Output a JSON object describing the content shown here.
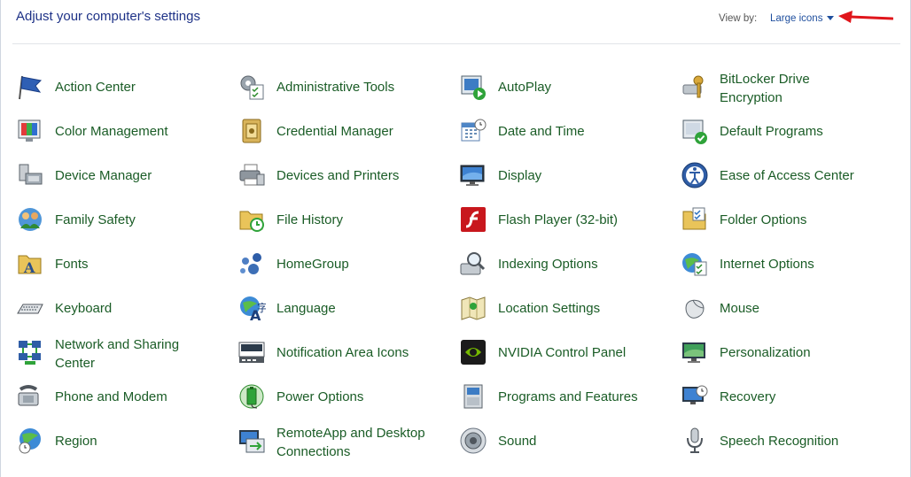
{
  "header": {
    "title": "Adjust your computer's settings",
    "view_by_label": "View by:",
    "view_by_value": "Large icons"
  },
  "accent_color": "#1a5c26",
  "annotation_color": "#e0151b",
  "items": [
    {
      "label": "Action Center",
      "icon": "flag-icon"
    },
    {
      "label": "Administrative Tools",
      "icon": "admin-tools-icon"
    },
    {
      "label": "AutoPlay",
      "icon": "autoplay-icon"
    },
    {
      "label": "BitLocker Drive Encryption",
      "icon": "bitlocker-keys-icon"
    },
    {
      "label": "Color Management",
      "icon": "color-management-icon"
    },
    {
      "label": "Credential Manager",
      "icon": "credential-vault-icon"
    },
    {
      "label": "Date and Time",
      "icon": "calendar-clock-icon"
    },
    {
      "label": "Default Programs",
      "icon": "default-programs-icon"
    },
    {
      "label": "Device Manager",
      "icon": "device-manager-icon"
    },
    {
      "label": "Devices and Printers",
      "icon": "printer-icon"
    },
    {
      "label": "Display",
      "icon": "monitor-icon"
    },
    {
      "label": "Ease of Access Center",
      "icon": "ease-of-access-icon"
    },
    {
      "label": "Family Safety",
      "icon": "family-safety-icon"
    },
    {
      "label": "File History",
      "icon": "file-history-icon"
    },
    {
      "label": "Flash Player (32-bit)",
      "icon": "flash-player-icon"
    },
    {
      "label": "Folder Options",
      "icon": "folder-options-icon"
    },
    {
      "label": "Fonts",
      "icon": "fonts-folder-icon"
    },
    {
      "label": "HomeGroup",
      "icon": "homegroup-icon"
    },
    {
      "label": "Indexing Options",
      "icon": "indexing-magnifier-icon"
    },
    {
      "label": "Internet Options",
      "icon": "internet-options-icon"
    },
    {
      "label": "Keyboard",
      "icon": "keyboard-icon"
    },
    {
      "label": "Language",
      "icon": "language-globe-icon"
    },
    {
      "label": "Location Settings",
      "icon": "location-map-icon"
    },
    {
      "label": "Mouse",
      "icon": "mouse-icon"
    },
    {
      "label": "Network and Sharing Center",
      "icon": "network-icon"
    },
    {
      "label": "Notification Area Icons",
      "icon": "notification-area-icon"
    },
    {
      "label": "NVIDIA Control Panel",
      "icon": "nvidia-icon"
    },
    {
      "label": "Personalization",
      "icon": "personalization-icon"
    },
    {
      "label": "Phone and Modem",
      "icon": "phone-modem-icon"
    },
    {
      "label": "Power Options",
      "icon": "battery-icon"
    },
    {
      "label": "Programs and Features",
      "icon": "programs-features-icon"
    },
    {
      "label": "Recovery",
      "icon": "recovery-icon"
    },
    {
      "label": "Region",
      "icon": "region-globe-icon"
    },
    {
      "label": "RemoteApp and Desktop Connections",
      "icon": "remoteapp-icon"
    },
    {
      "label": "Sound",
      "icon": "speaker-icon"
    },
    {
      "label": "Speech Recognition",
      "icon": "microphone-icon"
    }
  ]
}
